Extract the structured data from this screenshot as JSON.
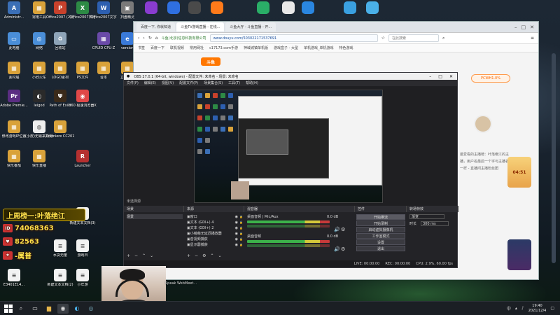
{
  "desktop": {
    "icons": [
      {
        "label": "Administr...",
        "color": "#3b6fb6",
        "glyph": "A"
      },
      {
        "label": "常用工具",
        "color": "#d9a23a",
        "glyph": "▦"
      },
      {
        "label": "Office2007 (2)打补丁",
        "color": "#c7412c",
        "glyph": "P"
      },
      {
        "label": "Office2007表格",
        "color": "#2d8a45",
        "glyph": "X"
      },
      {
        "label": "Office2007文字",
        "color": "#2d5fb0",
        "glyph": "W"
      },
      {
        "label": "扫盘精灵",
        "color": "#7a7a7a",
        "glyph": "▣"
      },
      {
        "label": "此电脑",
        "color": "#4a8ed8",
        "glyph": "▭"
      },
      {
        "label": "网络",
        "color": "#4a8ed8",
        "glyph": "◎"
      },
      {
        "label": "回收站",
        "color": "#8ea4b8",
        "glyph": "♻"
      },
      {
        "label": "素材展",
        "color": "#d9a23a",
        "glyph": "▦"
      },
      {
        "label": "小欣火车",
        "color": "#d9a23a",
        "glyph": "▦"
      },
      {
        "label": "LOGO素材",
        "color": "#d9a23a",
        "glyph": "▦"
      },
      {
        "label": "PS文件",
        "color": "#d9a23a",
        "glyph": "▦"
      },
      {
        "label": "Adobe Premie...",
        "color": "#5a2d82",
        "glyph": "Pr"
      },
      {
        "label": "leigod",
        "color": "#2a2a2a",
        "glyph": "◐"
      },
      {
        "label": "Path of Exile",
        "color": "#3a2a1a",
        "glyph": "Ψ"
      },
      {
        "label": "360 极速浏览器X",
        "color": "#e04848",
        "glyph": "◉"
      },
      {
        "label": "修改游戏IP位置",
        "color": "#d9a23a",
        "glyph": "▦"
      },
      {
        "label": "(小皮)无锡来捐用网络",
        "color": "#eeeeee",
        "glyph": "◍"
      },
      {
        "label": "Premiere CC2019",
        "color": "#d9a23a",
        "glyph": "▦"
      },
      {
        "label": "快乐番茄",
        "color": "#d9a23a",
        "glyph": "▦"
      },
      {
        "label": "快乐直播",
        "color": "#d9a23a",
        "glyph": "▦"
      },
      {
        "label": "Launcher",
        "color": "#b43030",
        "glyph": "R"
      },
      {
        "label": "CPUID CPU-Z",
        "color": "#6a4aa8",
        "glyph": "▦"
      },
      {
        "label": "version",
        "color": "#3a7ad8",
        "glyph": "e"
      },
      {
        "label": "台本",
        "color": "#d9a23a",
        "glyph": "▦"
      },
      {
        "label": "立地观测",
        "color": "#d9a23a",
        "glyph": "▦"
      },
      {
        "label": "新建文本文档(3)",
        "color": "#f2f2f2",
        "glyph": "≡"
      },
      {
        "label": "水货无废",
        "color": "#f2f2f2",
        "glyph": "≡"
      },
      {
        "label": "游戏日",
        "color": "#f2f2f2",
        "glyph": "≡"
      },
      {
        "label": "新建文本文档(2)",
        "color": "#f2f2f2",
        "glyph": "≡"
      },
      {
        "label": "小年游",
        "color": "#f2f2f2",
        "glyph": "≡"
      },
      {
        "label": "E3401E14...",
        "color": "#f2f2f2",
        "glyph": "≡"
      }
    ],
    "top_apps": [
      {
        "label": "Adobe",
        "color": "#8a3cd0"
      },
      {
        "label": "迅雷",
        "color": "#2f6fe0"
      },
      {
        "label": "游戏中心",
        "color": "#4a4a4a"
      },
      {
        "label": "斗鱼",
        "color": "#ff7a1a"
      },
      {
        "label": "微信",
        "color": "#2aae67"
      },
      {
        "label": "QQ",
        "color": "#e8e8e8"
      },
      {
        "label": "酷狗",
        "color": "#2a86e0"
      },
      {
        "label": "网易",
        "color": "#3aa0e0"
      },
      {
        "label": "迅雷影音",
        "color": "#4ab0e8"
      }
    ]
  },
  "overlay": {
    "banner": "上周榜一:叶落绝江",
    "id_text": "74068363",
    "line2": "82563",
    "line3": "-属普"
  },
  "browser": {
    "tabs": [
      {
        "label": "百度一下, 你就知道"
      },
      {
        "label": "斗鱼TV游戏直播 - 在线..."
      },
      {
        "label": "斗鱼大厅 - 斗鱼直播 - 开..."
      }
    ],
    "url": "www.douyu.com/503022171537691",
    "site_label": "斗鱼(北京)信息科技有限公司",
    "search_placeholder": "在此搜索",
    "bookmarks": [
      "书签",
      "百度一下",
      "联机视频",
      "常用网址",
      "c17173.com手游",
      "神域城镇单机版",
      "游戏盒子 - 大型",
      "单机游戏_单机游戏",
      "特色游戏"
    ],
    "logo": "斗鱼",
    "side_pill": "PCWH1.0%",
    "side_text": "最爱看的主播榜：叶落绝江的主播，用户名最后一个字与主播名一样 - 直播间主播粉丝团",
    "ad_label": "04:51"
  },
  "obs": {
    "title": "OBS 27.0.1 (64-bit, windows) - 配置文件: 未命名 - 场景: 未命名",
    "menu": [
      "文件(F)",
      "编辑(E)",
      "视图(V)",
      "配置文件(P)",
      "场景集合(S)",
      "工具(T)",
      "帮助(H)"
    ],
    "panels": {
      "scenes_title": "场景",
      "sources_title": "来源",
      "mixer_title": "混音器",
      "transitions_title": "转场特效",
      "controls_title": "控件"
    },
    "no_source": "未选择源",
    "scene_item": "场景",
    "sources": [
      "窗口",
      "文本 (GDI+) 4",
      "文本 (GDI+) 2",
      "小萌萌无延迟播放器",
      "音视频捕获",
      "显示器捕获"
    ],
    "mixer_items": [
      {
        "name": "桌面音频 | Mic/Aux",
        "level": "0.0 dB"
      },
      {
        "name": "桌面音频",
        "level": "0.0 dB"
      }
    ],
    "transition": {
      "name": "渐变",
      "duration_label": "时长",
      "duration": "300 ms"
    },
    "controls": [
      "开始推流",
      "开始录制",
      "启动虚拟摄像机",
      "工作室模式",
      "设置",
      "退出"
    ],
    "status": {
      "live": "LIVE: 00:00:00",
      "rec": "REC: 00:00:00",
      "cpu": "CPU: 2.9%, 60.00 fps"
    }
  },
  "webcam_caption": "Speak WebMeet...",
  "taskbar": {
    "clock_time": "19:40",
    "clock_date": "2021/12/4",
    "lang": "中"
  }
}
